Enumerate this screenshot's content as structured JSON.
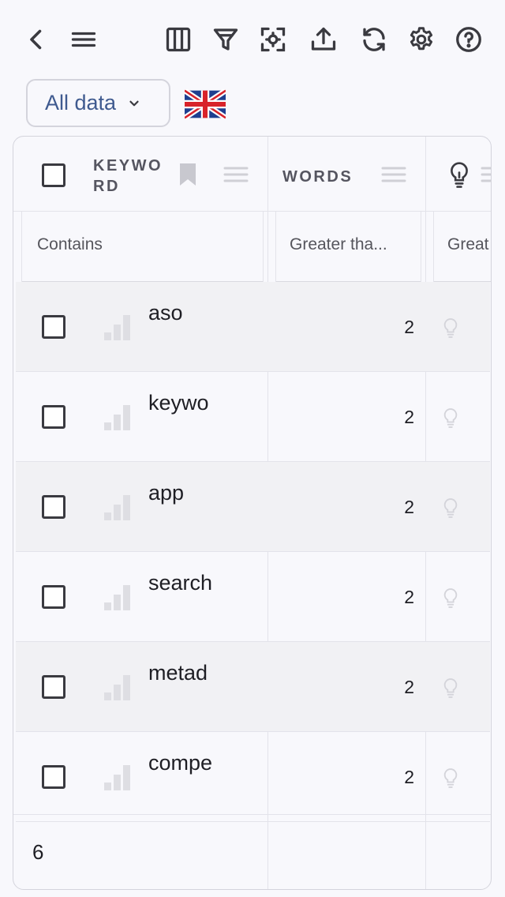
{
  "toolbar": {
    "icons": [
      "back-icon",
      "hamburger-icon",
      "columns-icon",
      "filter-icon",
      "focus-icon",
      "export-icon",
      "refresh-icon",
      "settings-icon",
      "help-icon"
    ]
  },
  "data_select": {
    "label": "All data"
  },
  "flag": {
    "name": "uk-flag-icon"
  },
  "table": {
    "columns": [
      {
        "header_line1": "KEYWO",
        "header_line2": "RD",
        "filter": "Contains"
      },
      {
        "header": "WORDS",
        "filter": "Greater tha..."
      },
      {
        "header_icon": "lightbulb-icon",
        "filter": "Great"
      }
    ],
    "rows": [
      {
        "keyword": "aso",
        "words": "2"
      },
      {
        "keyword": "keywo",
        "words": "2"
      },
      {
        "keyword": "app",
        "words": "2"
      },
      {
        "keyword": "search",
        "words": "2"
      },
      {
        "keyword": "metad",
        "words": "2"
      },
      {
        "keyword": "compe",
        "words": "2"
      }
    ],
    "footer_count": "6"
  },
  "colors": {
    "accent": "#3f5a8f",
    "background": "#f8f8fc",
    "row_shade": "#f1f1f4",
    "border": "#d4d4dc"
  }
}
